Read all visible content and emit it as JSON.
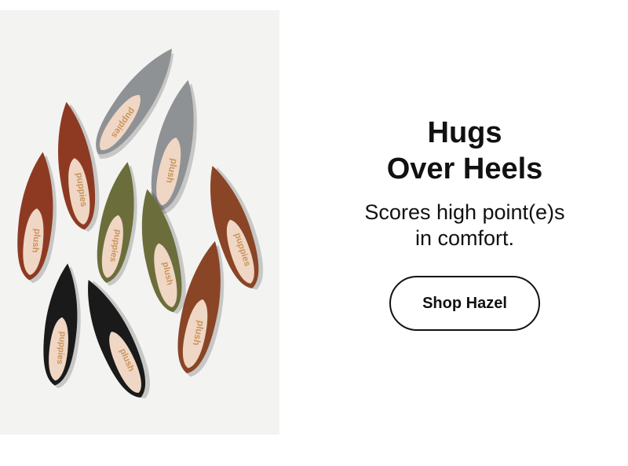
{
  "hero": {
    "image_alt": "Pointed-toe suede flats in grey, rust, olive, brown and black",
    "headline_line1": "Hugs",
    "headline_line2": "Over Heels",
    "subhead_line1": "Scores high point(e)s",
    "subhead_line2": "in comfort.",
    "cta_label": "Shop Hazel"
  },
  "shoe_insole_logos": [
    "puppies",
    "plush",
    "puppies",
    "plush",
    "puppies",
    "plush",
    "puppies",
    "plush",
    "puppies",
    "plush",
    "puppies"
  ],
  "colors": {
    "text": "#111111",
    "photo_background": "#f3f3f2",
    "grey": "#8f9294",
    "rust": "#8e3a22",
    "olive": "#6b6e3a",
    "brown": "#8a4526",
    "black": "#1a1a1a",
    "insole": "#f0d6c4"
  }
}
